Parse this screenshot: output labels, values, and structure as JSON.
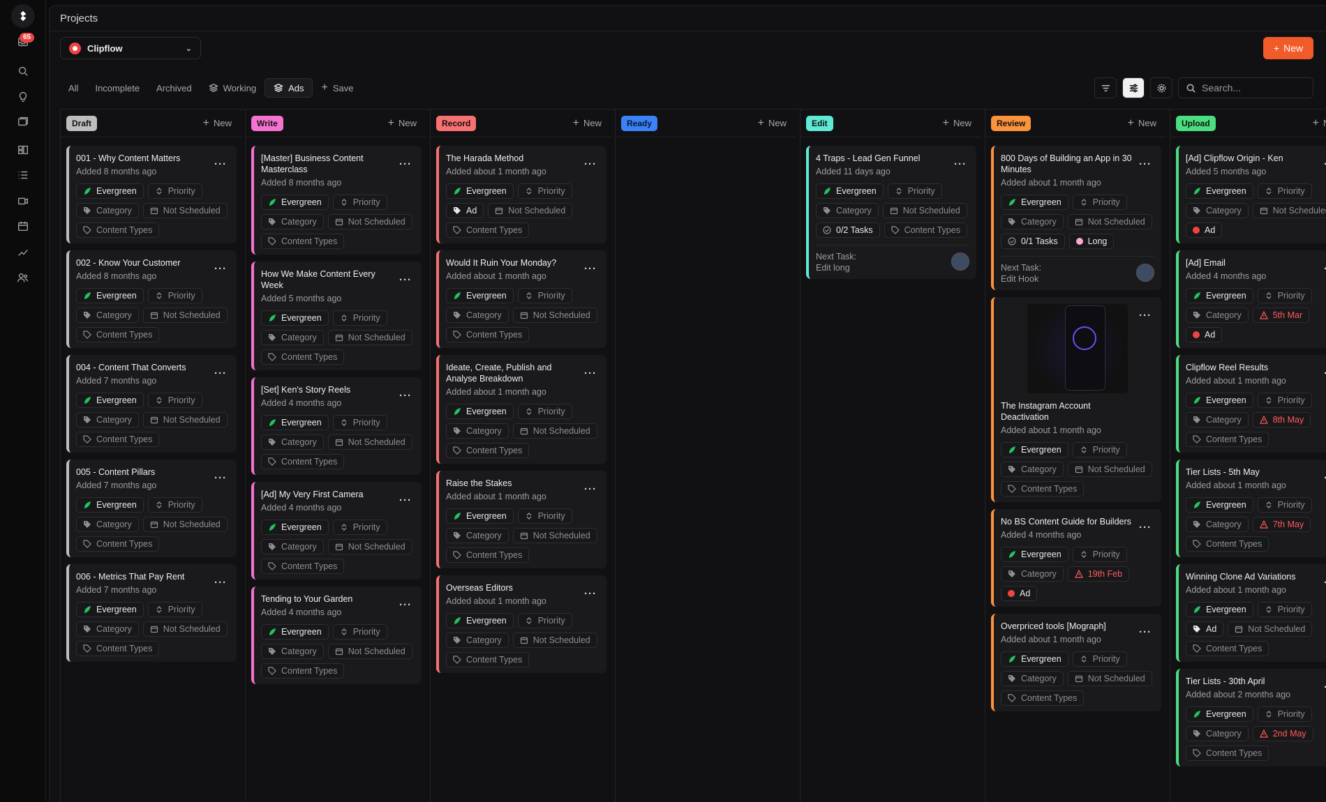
{
  "app": {
    "notification_count": "65"
  },
  "header": {
    "title": "Projects"
  },
  "workspace": {
    "name": "Clipflow"
  },
  "new_button": "New",
  "filters": [
    "All",
    "Incomplete",
    "Archived",
    "Working",
    "Ads",
    "Save"
  ],
  "search": {
    "placeholder": "Search..."
  },
  "colors": {
    "accent": "#f15a29",
    "evergreen": "#22c55e",
    "warning": "#ff5a5a"
  },
  "columns": [
    {
      "name": "Draft",
      "color": "#bdbdbd",
      "text": "#111",
      "add": "New",
      "cards": [
        {
          "title": "001 - Why Content Matters",
          "added": "Added 8 months ago",
          "chips": [
            [
              "ever",
              "Evergreen"
            ],
            [
              "pri",
              "Priority"
            ],
            [
              "cat",
              "Category"
            ],
            [
              "cal",
              "Not Scheduled"
            ],
            [
              "ct",
              "Content Types"
            ]
          ]
        },
        {
          "title": "002 - Know Your Customer",
          "added": "Added 8 months ago",
          "chips": [
            [
              "ever",
              "Evergreen"
            ],
            [
              "pri",
              "Priority"
            ],
            [
              "cat",
              "Category"
            ],
            [
              "cal",
              "Not Scheduled"
            ],
            [
              "ct",
              "Content Types"
            ]
          ]
        },
        {
          "title": "004 - Content That Converts",
          "added": "Added 7 months ago",
          "chips": [
            [
              "ever",
              "Evergreen"
            ],
            [
              "pri",
              "Priority"
            ],
            [
              "cat",
              "Category"
            ],
            [
              "cal",
              "Not Scheduled"
            ],
            [
              "ct",
              "Content Types"
            ]
          ]
        },
        {
          "title": "005 - Content Pillars",
          "added": "Added 7 months ago",
          "chips": [
            [
              "ever",
              "Evergreen"
            ],
            [
              "pri",
              "Priority"
            ],
            [
              "cat",
              "Category"
            ],
            [
              "cal",
              "Not Scheduled"
            ],
            [
              "ct",
              "Content Types"
            ]
          ]
        },
        {
          "title": "006 - Metrics That Pay Rent",
          "added": "Added 7 months ago",
          "chips": [
            [
              "ever",
              "Evergreen"
            ],
            [
              "pri",
              "Priority"
            ],
            [
              "cat",
              "Category"
            ],
            [
              "cal",
              "Not Scheduled"
            ],
            [
              "ct",
              "Content Types"
            ]
          ]
        }
      ]
    },
    {
      "name": "Write",
      "color": "#f472d0",
      "text": "#111",
      "add": "New",
      "cards": [
        {
          "title": "[Master] Business Content Masterclass",
          "added": "Added 8 months ago",
          "chips": [
            [
              "ever",
              "Evergreen"
            ],
            [
              "pri",
              "Priority"
            ],
            [
              "cat",
              "Category"
            ],
            [
              "cal",
              "Not Scheduled"
            ],
            [
              "ct",
              "Content Types"
            ]
          ]
        },
        {
          "title": "How We Make Content Every Week",
          "added": "Added 5 months ago",
          "chips": [
            [
              "ever",
              "Evergreen"
            ],
            [
              "pri",
              "Priority"
            ],
            [
              "cat",
              "Category"
            ],
            [
              "cal",
              "Not Scheduled"
            ],
            [
              "ct",
              "Content Types"
            ]
          ]
        },
        {
          "title": "[Set] Ken's Story Reels",
          "added": "Added 4 months ago",
          "chips": [
            [
              "ever",
              "Evergreen"
            ],
            [
              "pri",
              "Priority"
            ],
            [
              "cat",
              "Category"
            ],
            [
              "cal",
              "Not Scheduled"
            ],
            [
              "ct",
              "Content Types"
            ]
          ]
        },
        {
          "title": "[Ad] My Very First Camera",
          "added": "Added 4 months ago",
          "chips": [
            [
              "ever",
              "Evergreen"
            ],
            [
              "pri",
              "Priority"
            ],
            [
              "cat",
              "Category"
            ],
            [
              "cal",
              "Not Scheduled"
            ],
            [
              "ct",
              "Content Types"
            ]
          ]
        },
        {
          "title": "Tending to Your Garden",
          "added": "Added 4 months ago",
          "chips": [
            [
              "ever",
              "Evergreen"
            ],
            [
              "pri",
              "Priority"
            ],
            [
              "cat",
              "Category"
            ],
            [
              "cal",
              "Not Scheduled"
            ],
            [
              "ct",
              "Content Types"
            ]
          ]
        }
      ]
    },
    {
      "name": "Record",
      "color": "#f87171",
      "text": "#111",
      "add": "New",
      "cards": [
        {
          "title": "The Harada Method",
          "added": "Added about 1 month ago",
          "chips": [
            [
              "ever",
              "Evergreen"
            ],
            [
              "pri",
              "Priority"
            ],
            [
              "adtag",
              "Ad"
            ],
            [
              "cal",
              "Not Scheduled"
            ],
            [
              "ct",
              "Content Types"
            ]
          ]
        },
        {
          "title": "Would It Ruin Your Monday?",
          "added": "Added about 1 month ago",
          "chips": [
            [
              "ever",
              "Evergreen"
            ],
            [
              "pri",
              "Priority"
            ],
            [
              "cat",
              "Category"
            ],
            [
              "cal",
              "Not Scheduled"
            ],
            [
              "ct",
              "Content Types"
            ]
          ]
        },
        {
          "title": "Ideate, Create, Publish and Analyse Breakdown",
          "added": "Added about 1 month ago",
          "chips": [
            [
              "ever",
              "Evergreen"
            ],
            [
              "pri",
              "Priority"
            ],
            [
              "cat",
              "Category"
            ],
            [
              "cal",
              "Not Scheduled"
            ],
            [
              "ct",
              "Content Types"
            ]
          ]
        },
        {
          "title": "Raise the Stakes",
          "added": "Added about 1 month ago",
          "chips": [
            [
              "ever",
              "Evergreen"
            ],
            [
              "pri",
              "Priority"
            ],
            [
              "cat",
              "Category"
            ],
            [
              "cal",
              "Not Scheduled"
            ],
            [
              "ct",
              "Content Types"
            ]
          ]
        },
        {
          "title": "Overseas Editors",
          "added": "Added about 1 month ago",
          "chips": [
            [
              "ever",
              "Evergreen"
            ],
            [
              "pri",
              "Priority"
            ],
            [
              "cat",
              "Category"
            ],
            [
              "cal",
              "Not Scheduled"
            ],
            [
              "ct",
              "Content Types"
            ]
          ]
        }
      ]
    },
    {
      "name": "Ready",
      "color": "#3b82f6",
      "text": "#0b1a33",
      "add": "New",
      "cards": []
    },
    {
      "name": "Edit",
      "color": "#5eead4",
      "text": "#111",
      "add": "New",
      "cards": [
        {
          "title": "4 Traps - Lead Gen Funnel",
          "added": "Added 11 days ago",
          "chips": [
            [
              "ever",
              "Evergreen"
            ],
            [
              "pri",
              "Priority"
            ],
            [
              "cat",
              "Category"
            ],
            [
              "cal",
              "Not Scheduled"
            ],
            [
              "task",
              "0/2 Tasks"
            ],
            [
              "ct",
              "Content Types"
            ]
          ],
          "next_label": "Next Task:",
          "next_value": "Edit long",
          "avatar": true
        }
      ]
    },
    {
      "name": "Review",
      "color": "#fb923c",
      "text": "#111",
      "add": "New",
      "cards": [
        {
          "title": "800 Days of Building an App in 30 Minutes",
          "added": "Added about 1 month ago",
          "chips": [
            [
              "ever",
              "Evergreen"
            ],
            [
              "pri",
              "Priority"
            ],
            [
              "cat",
              "Category"
            ],
            [
              "cal",
              "Not Scheduled"
            ],
            [
              "task",
              "0/1 Tasks"
            ],
            [
              "long",
              "Long"
            ]
          ],
          "next_label": "Next Task:",
          "next_value": "Edit Hook",
          "avatar": true
        },
        {
          "title": "The Instagram Account Deactivation",
          "added": "Added about 1 month ago",
          "thumb": true,
          "chips": [
            [
              "ever",
              "Evergreen"
            ],
            [
              "pri",
              "Priority"
            ],
            [
              "cat",
              "Category"
            ],
            [
              "cal",
              "Not Scheduled"
            ],
            [
              "ct",
              "Content Types"
            ]
          ]
        },
        {
          "title": "No BS Content Guide for Builders",
          "added": "Added 4 months ago",
          "chips": [
            [
              "ever",
              "Evergreen"
            ],
            [
              "pri",
              "Priority"
            ],
            [
              "cat",
              "Category"
            ],
            [
              "warn",
              "19th Feb"
            ],
            [
              "addot",
              "Ad"
            ]
          ]
        },
        {
          "title": "Overpriced tools [Mograph]",
          "added": "Added about 1 month ago",
          "chips": [
            [
              "ever",
              "Evergreen"
            ],
            [
              "pri",
              "Priority"
            ],
            [
              "cat",
              "Category"
            ],
            [
              "cal",
              "Not Scheduled"
            ],
            [
              "ct",
              "Content Types"
            ]
          ]
        }
      ]
    },
    {
      "name": "Upload",
      "color": "#4ade80",
      "text": "#111",
      "add": "New",
      "cards": [
        {
          "title": "[Ad] Clipflow Origin - Ken",
          "added": "Added 5 months ago",
          "chips": [
            [
              "ever",
              "Evergreen"
            ],
            [
              "pri",
              "Priority"
            ],
            [
              "cat",
              "Category"
            ],
            [
              "cal",
              "Not Scheduled"
            ],
            [
              "addot",
              "Ad"
            ]
          ]
        },
        {
          "title": "[Ad] Email",
          "added": "Added 4 months ago",
          "chips": [
            [
              "ever",
              "Evergreen"
            ],
            [
              "pri",
              "Priority"
            ],
            [
              "cat",
              "Category"
            ],
            [
              "warn",
              "5th Mar"
            ],
            [
              "addot",
              "Ad"
            ]
          ]
        },
        {
          "title": "Clipflow Reel Results",
          "added": "Added about 1 month ago",
          "chips": [
            [
              "ever",
              "Evergreen"
            ],
            [
              "pri",
              "Priority"
            ],
            [
              "cat",
              "Category"
            ],
            [
              "warn",
              "8th May"
            ],
            [
              "ct",
              "Content Types"
            ]
          ]
        },
        {
          "title": "Tier Lists - 5th May",
          "added": "Added about 1 month ago",
          "chips": [
            [
              "ever",
              "Evergreen"
            ],
            [
              "pri",
              "Priority"
            ],
            [
              "cat",
              "Category"
            ],
            [
              "warn",
              "7th May"
            ],
            [
              "ct",
              "Content Types"
            ]
          ]
        },
        {
          "title": "Winning Clone Ad Variations",
          "added": "Added about 1 month ago",
          "chips": [
            [
              "ever",
              "Evergreen"
            ],
            [
              "pri",
              "Priority"
            ],
            [
              "adtag",
              "Ad"
            ],
            [
              "cal",
              "Not Scheduled"
            ],
            [
              "ct",
              "Content Types"
            ]
          ]
        },
        {
          "title": "Tier Lists - 30th April",
          "added": "Added about 2 months ago",
          "chips": [
            [
              "ever",
              "Evergreen"
            ],
            [
              "pri",
              "Priority"
            ],
            [
              "cat",
              "Category"
            ],
            [
              "warn",
              "2nd May"
            ],
            [
              "ct",
              "Content Types"
            ]
          ]
        }
      ]
    }
  ]
}
